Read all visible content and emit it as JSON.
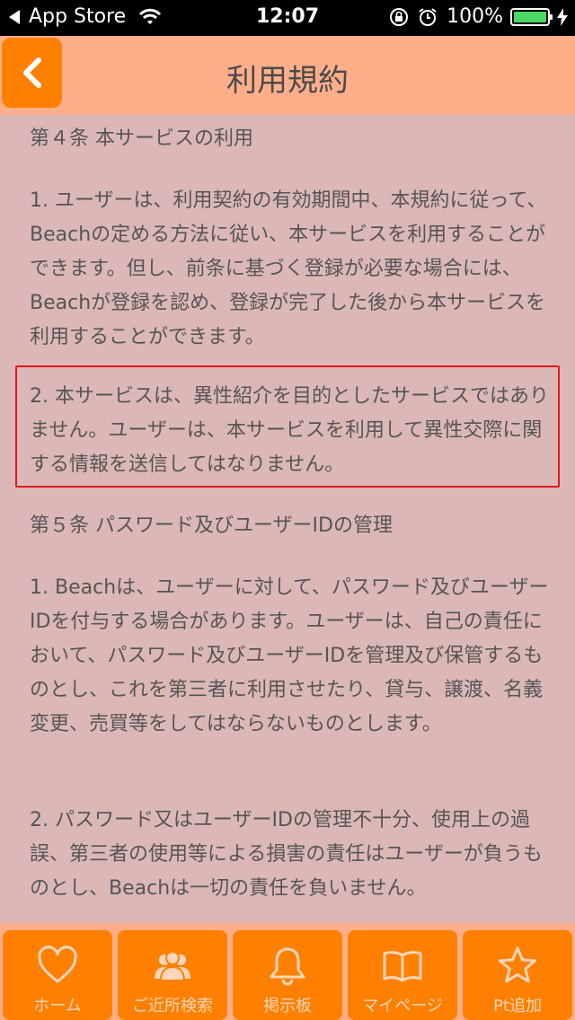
{
  "status_bar": {
    "back_app": "App Store",
    "time": "12:07",
    "battery": "100%"
  },
  "header": {
    "title": "利用規約",
    "back_icon": "chevron-left-icon"
  },
  "content": {
    "paragraphs": [
      "第４条 本サービスの利用",
      "1. ユーザーは、利用契約の有効期間中、本規約に従って、Beachの定める方法に従い、本サービスを利用することができます。但し、前条に基づく登録が必要な場合には、Beachが登録を認め、登録が完了した後から本サービスを利用することができます。",
      "2. 本サービスは、異性紹介を目的としたサービスではありません。ユーザーは、本サービスを利用して異性交際に関する情報を送信してはなりません。",
      "第５条 パスワード及びユーザーIDの管理",
      "1. Beachは、ユーザーに対して、パスワード及びユーザーIDを付与する場合があります。ユーザーは、自己の責任において、パスワード及びユーザーIDを管理及び保管するものとし、これを第三者に利用させたり、貸与、譲渡、名義変更、売買等をしてはならないものとします。",
      "2. パスワード又はユーザーIDの管理不十分、使用上の過誤、第三者の使用等による損害の責任はユーザーが負うものとし、Beachは一切の責任を負いません。"
    ]
  },
  "tabs": [
    {
      "label": "ホーム",
      "icon": "heart-icon"
    },
    {
      "label": "ご近所検索",
      "icon": "people-icon"
    },
    {
      "label": "掲示板",
      "icon": "bell-icon"
    },
    {
      "label": "マイページ",
      "icon": "book-icon"
    },
    {
      "label": "Pt追加",
      "icon": "star-icon"
    }
  ],
  "colors": {
    "accent": "#ff8000",
    "header_bg": "#ffae8a",
    "content_bg": "#dcb7b8",
    "highlight_border": "#e6161c"
  }
}
